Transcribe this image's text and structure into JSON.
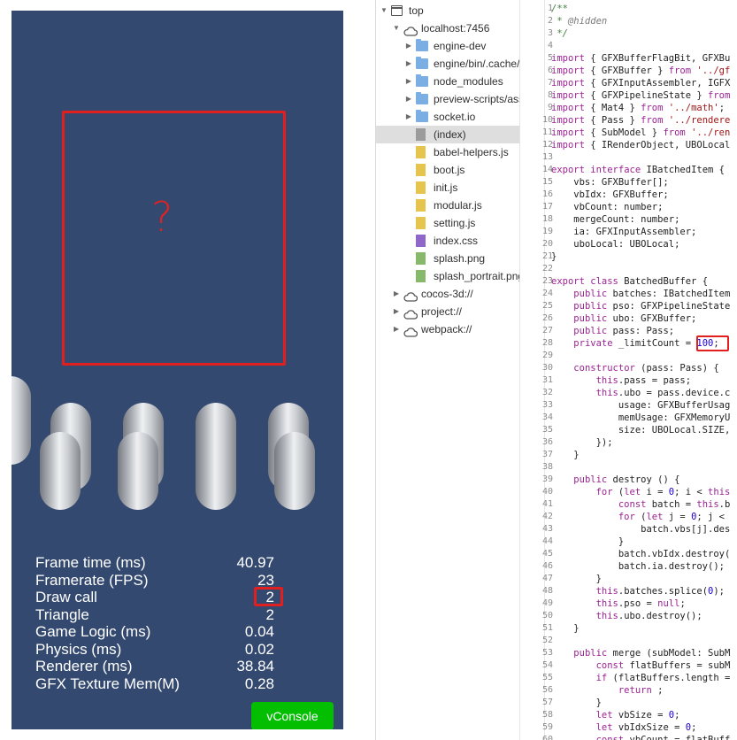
{
  "preview": {
    "question_mark": "?",
    "stats": [
      {
        "label": "Frame time (ms)",
        "value": "40.97"
      },
      {
        "label": "Framerate (FPS)",
        "value": "23"
      },
      {
        "label": "Draw call",
        "value": "2"
      },
      {
        "label": "Triangle",
        "value": "2"
      },
      {
        "label": "Game Logic (ms)",
        "value": "0.04"
      },
      {
        "label": "Physics (ms)",
        "value": "0.02"
      },
      {
        "label": "Renderer (ms)",
        "value": "38.84"
      },
      {
        "label": "GFX Texture Mem(M)",
        "value": "0.28"
      }
    ],
    "vconsole_label": "vConsole",
    "colors": {
      "background": "#34496f",
      "highlight": "#e11f1f",
      "vconsole": "#04be02"
    }
  },
  "file_tree": {
    "rows": [
      {
        "label": "top",
        "icon": "frame-icon",
        "expanded": true
      },
      {
        "label": "localhost:7456",
        "icon": "cloud-icon",
        "expanded": true
      },
      {
        "label": "engine-dev",
        "icon": "folder-icon"
      },
      {
        "label": "engine/bin/.cache/",
        "icon": "folder-icon"
      },
      {
        "label": "node_modules",
        "icon": "folder-icon"
      },
      {
        "label": "preview-scripts/ass",
        "icon": "folder-icon"
      },
      {
        "label": "socket.io",
        "icon": "folder-icon"
      },
      {
        "label": "(index)",
        "icon": "document-icon",
        "selected": true
      },
      {
        "label": "babel-helpers.js",
        "icon": "js-file-icon"
      },
      {
        "label": "boot.js",
        "icon": "js-file-icon"
      },
      {
        "label": "init.js",
        "icon": "js-file-icon"
      },
      {
        "label": "modular.js",
        "icon": "js-file-icon"
      },
      {
        "label": "setting.js",
        "icon": "js-file-icon"
      },
      {
        "label": "index.css",
        "icon": "css-file-icon"
      },
      {
        "label": "splash.png",
        "icon": "image-file-icon"
      },
      {
        "label": "splash_portrait.png",
        "icon": "image-file-icon"
      },
      {
        "label": "cocos-3d://",
        "icon": "cloud-icon"
      },
      {
        "label": "project://",
        "icon": "cloud-icon"
      },
      {
        "label": "webpack://",
        "icon": "cloud-icon"
      }
    ]
  },
  "editor": {
    "highlighted_value": "100;",
    "lines": [
      {
        "n": "1",
        "text": "/**"
      },
      {
        "n": "2",
        "text": " * @hidden"
      },
      {
        "n": "3",
        "text": " */"
      },
      {
        "n": "4",
        "text": ""
      },
      {
        "n": "5",
        "text": "import { GFXBufferFlagBit, GFXBu"
      },
      {
        "n": "6",
        "text": "import { GFXBuffer } from '../gf"
      },
      {
        "n": "7",
        "text": "import { GFXInputAssembler, IGFX"
      },
      {
        "n": "8",
        "text": "import { GFXPipelineState } from"
      },
      {
        "n": "9",
        "text": "import { Mat4 } from '../math';"
      },
      {
        "n": "10",
        "text": "import { Pass } from '../rendere"
      },
      {
        "n": "11",
        "text": "import { SubModel } from '../ren"
      },
      {
        "n": "12",
        "text": "import { IRenderObject, UBOLocal"
      },
      {
        "n": "13",
        "text": ""
      },
      {
        "n": "14",
        "text": "export interface IBatchedItem {"
      },
      {
        "n": "15",
        "text": "    vbs: GFXBuffer[];"
      },
      {
        "n": "16",
        "text": "    vbIdx: GFXBuffer;"
      },
      {
        "n": "17",
        "text": "    vbCount: number;"
      },
      {
        "n": "18",
        "text": "    mergeCount: number;"
      },
      {
        "n": "19",
        "text": "    ia: GFXInputAssembler;"
      },
      {
        "n": "20",
        "text": "    uboLocal: UBOLocal;"
      },
      {
        "n": "21",
        "text": "}"
      },
      {
        "n": "22",
        "text": ""
      },
      {
        "n": "23",
        "text": "export class BatchedBuffer {"
      },
      {
        "n": "24",
        "text": "    public batches: IBatchedItem"
      },
      {
        "n": "25",
        "text": "    public pso: GFXPipelineState"
      },
      {
        "n": "26",
        "text": "    public ubo: GFXBuffer;"
      },
      {
        "n": "27",
        "text": "    public pass: Pass;"
      },
      {
        "n": "28",
        "text": "    private _limitCount = 100;"
      },
      {
        "n": "29",
        "text": ""
      },
      {
        "n": "30",
        "text": "    constructor (pass: Pass) {"
      },
      {
        "n": "31",
        "text": "        this.pass = pass;"
      },
      {
        "n": "32",
        "text": "        this.ubo = pass.device.c"
      },
      {
        "n": "33",
        "text": "            usage: GFXBufferUsag"
      },
      {
        "n": "34",
        "text": "            memUsage: GFXMemoryU"
      },
      {
        "n": "35",
        "text": "            size: UBOLocal.SIZE,"
      },
      {
        "n": "36",
        "text": "        });"
      },
      {
        "n": "37",
        "text": "    }"
      },
      {
        "n": "38",
        "text": ""
      },
      {
        "n": "39",
        "text": "    public destroy () {"
      },
      {
        "n": "40",
        "text": "        for (let i = 0; i < this"
      },
      {
        "n": "41",
        "text": "            const batch = this.b"
      },
      {
        "n": "42",
        "text": "            for (let j = 0; j <"
      },
      {
        "n": "43",
        "text": "                batch.vbs[j].des"
      },
      {
        "n": "44",
        "text": "            }"
      },
      {
        "n": "45",
        "text": "            batch.vbIdx.destroy("
      },
      {
        "n": "46",
        "text": "            batch.ia.destroy();"
      },
      {
        "n": "47",
        "text": "        }"
      },
      {
        "n": "48",
        "text": "        this.batches.splice(0);"
      },
      {
        "n": "49",
        "text": "        this.pso = null;"
      },
      {
        "n": "50",
        "text": "        this.ubo.destroy();"
      },
      {
        "n": "51",
        "text": "    }"
      },
      {
        "n": "52",
        "text": ""
      },
      {
        "n": "53",
        "text": "    public merge (subModel: SubM"
      },
      {
        "n": "54",
        "text": "        const flatBuffers = subM"
      },
      {
        "n": "55",
        "text": "        if (flatBuffers.length ="
      },
      {
        "n": "56",
        "text": "            return ;"
      },
      {
        "n": "57",
        "text": "        }"
      },
      {
        "n": "58",
        "text": "        let vbSize = 0;"
      },
      {
        "n": "59",
        "text": "        let vbIdxSize = 0;"
      },
      {
        "n": "60",
        "text": "        const vbCount = flatBuff"
      }
    ]
  }
}
